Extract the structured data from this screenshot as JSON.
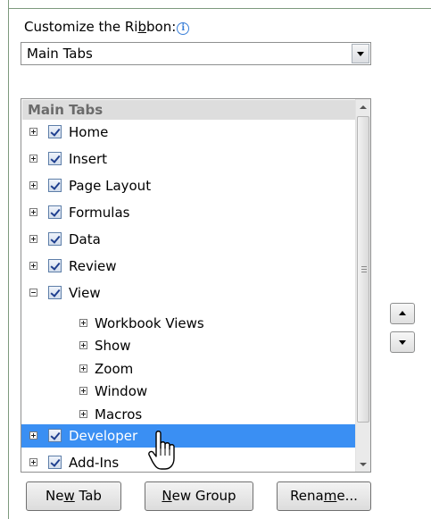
{
  "heading": {
    "before_access": "Customize the Ri",
    "access_key": "b",
    "after_access": "bon:",
    "info_icon": "info-icon"
  },
  "dropdown": {
    "value": "Main Tabs"
  },
  "tree": {
    "header": "Main Tabs",
    "items": [
      {
        "label": "Home",
        "checked": true,
        "expanded": false
      },
      {
        "label": "Insert",
        "checked": true,
        "expanded": false
      },
      {
        "label": "Page Layout",
        "checked": true,
        "expanded": false
      },
      {
        "label": "Formulas",
        "checked": true,
        "expanded": false
      },
      {
        "label": "Data",
        "checked": true,
        "expanded": false
      },
      {
        "label": "Review",
        "checked": true,
        "expanded": false
      },
      {
        "label": "View",
        "checked": true,
        "expanded": true,
        "groups": [
          "Workbook Views",
          "Show",
          "Zoom",
          "Window",
          "Macros"
        ]
      },
      {
        "label": "Developer",
        "checked": true,
        "expanded": false,
        "selected": true
      },
      {
        "label": "Add-Ins",
        "checked": true,
        "expanded": false
      }
    ]
  },
  "buttons": {
    "new_tab": {
      "before": "Ne",
      "key": "w",
      "after": " Tab"
    },
    "new_group": {
      "before": "",
      "key": "N",
      "after": "ew Group"
    },
    "rename": {
      "before": "Rena",
      "key": "m",
      "after": "e..."
    }
  },
  "icons": {
    "move_up": "arrow-up-icon",
    "move_down": "arrow-down-icon",
    "cursor": "hand-pointer-icon"
  },
  "colors": {
    "selection": "#3a8ff3",
    "header_bg": "#dddddd",
    "info_blue": "#3a7fd8"
  }
}
